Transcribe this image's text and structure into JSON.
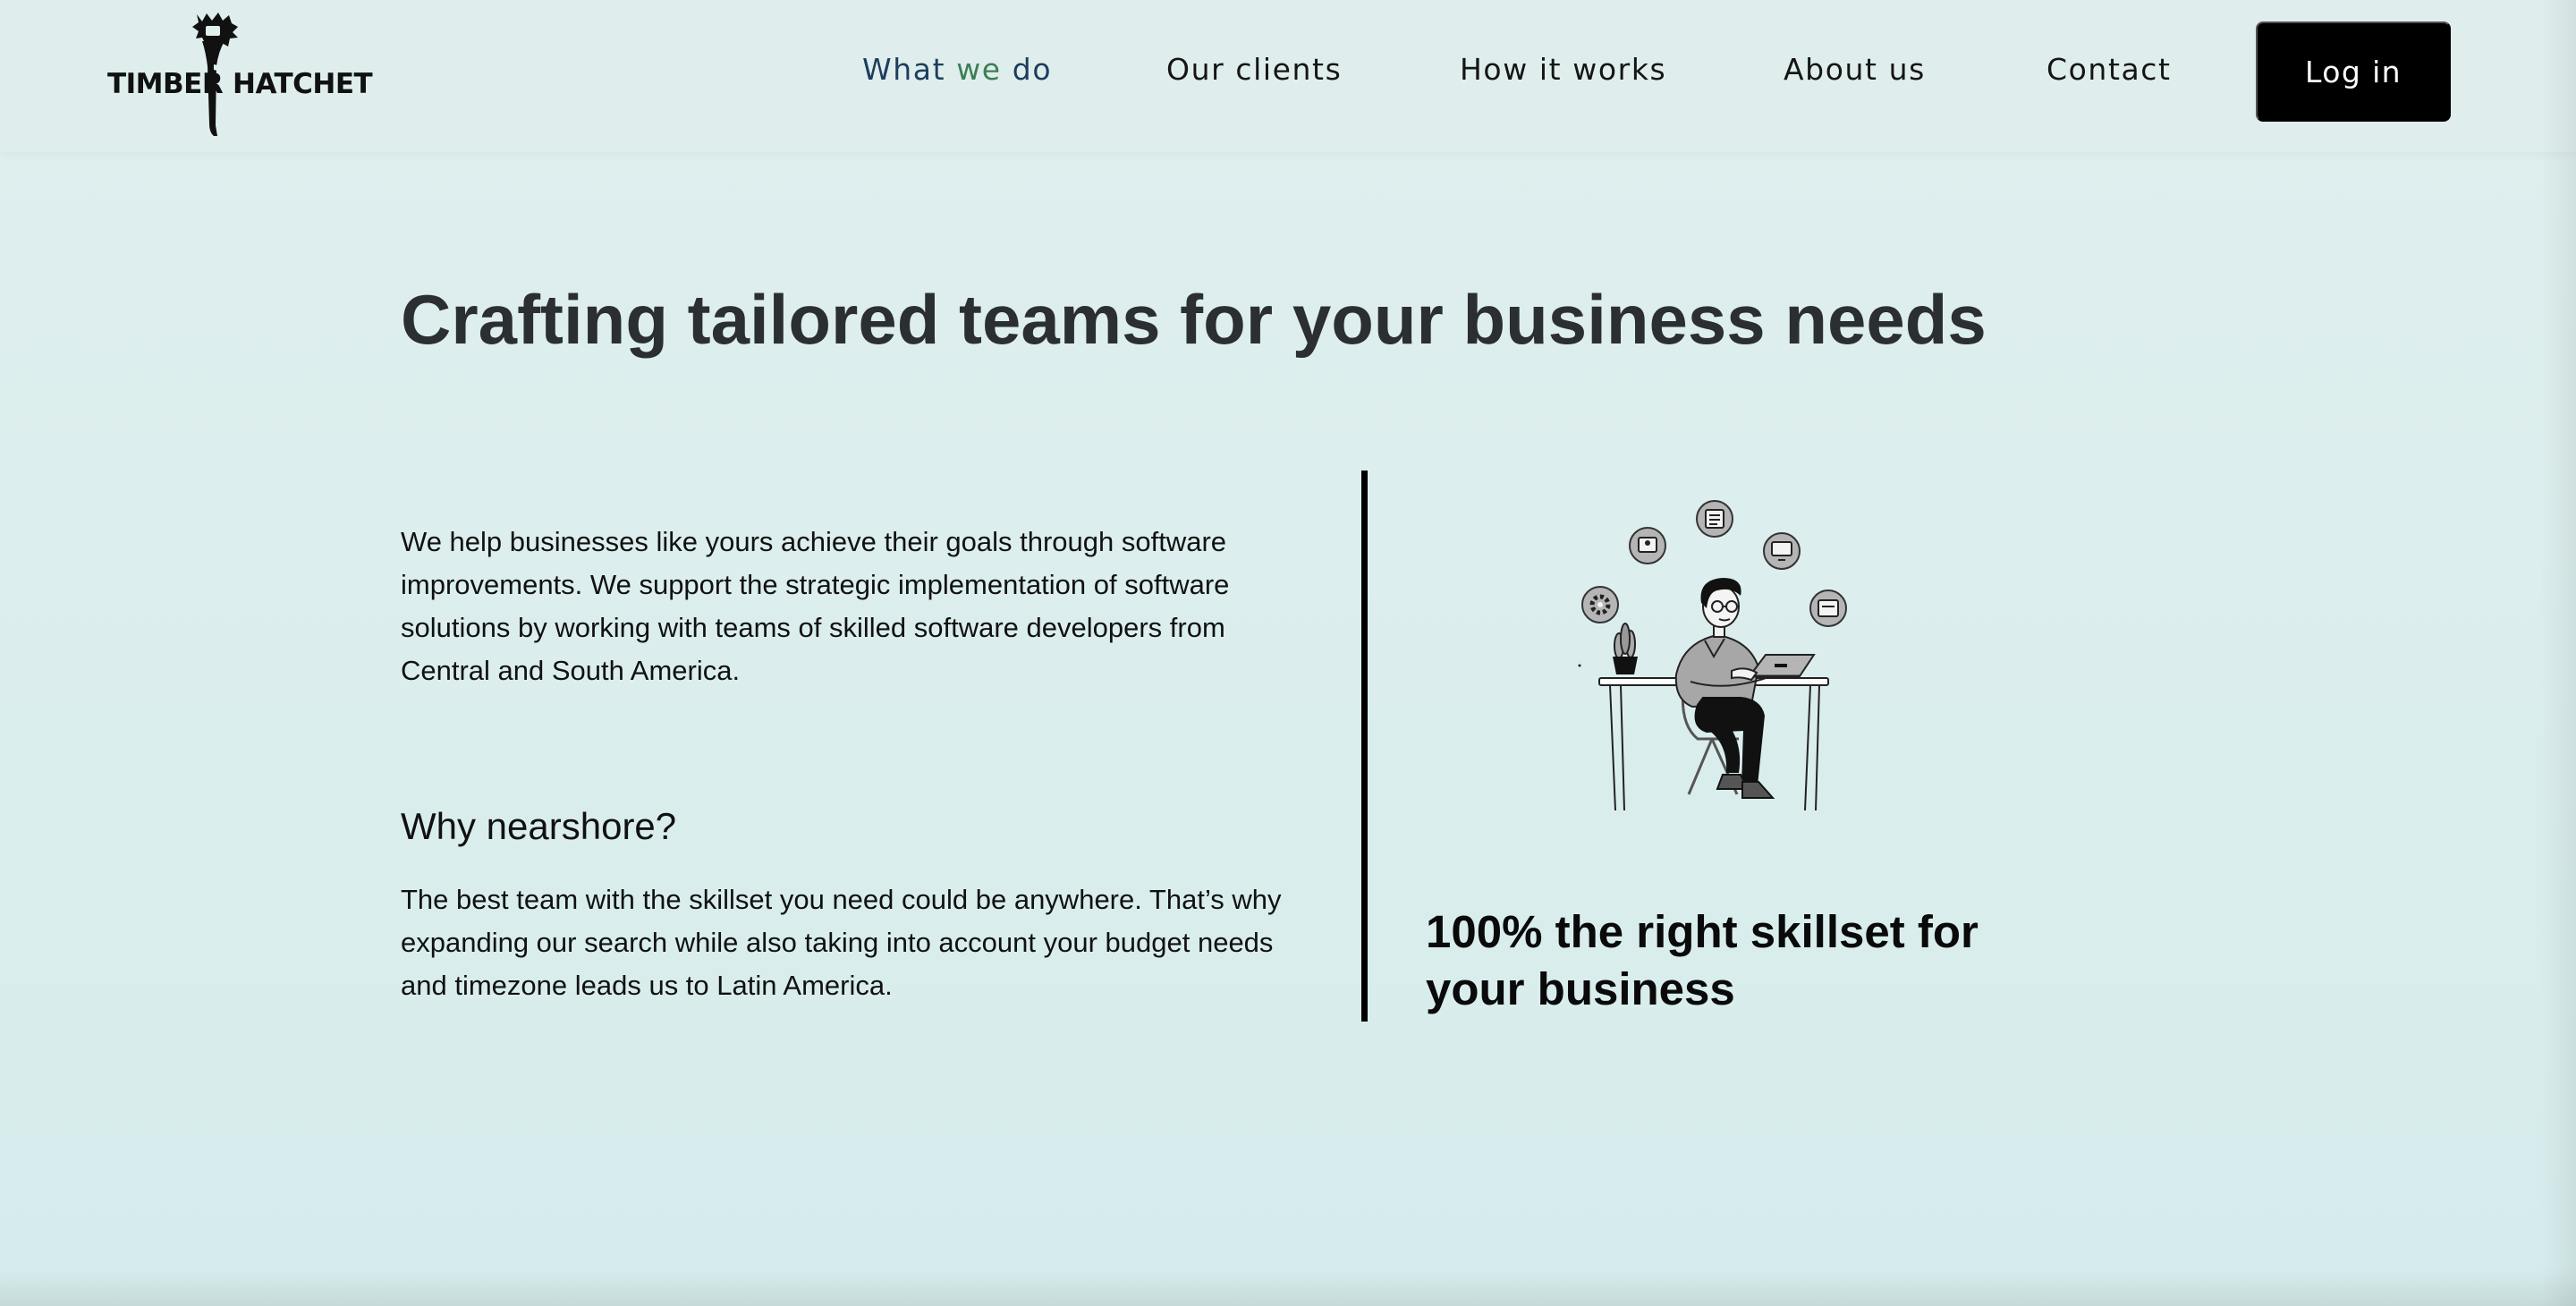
{
  "header": {
    "logo": {
      "text_left": "TIMBER",
      "text_right": "HATCHET"
    },
    "nav": [
      {
        "label": "What we do",
        "label_start": "What ",
        "label_accent": "we",
        "label_end": " do",
        "active": true
      },
      {
        "label": "Our clients"
      },
      {
        "label": "How it works"
      },
      {
        "label": "About us"
      },
      {
        "label": "Contact"
      }
    ],
    "login_label": "Log in"
  },
  "hero": {
    "title": "Crafting tailored teams for your business needs",
    "intro": "We help businesses like yours achieve their goals through software improvements. We support the strategic implementation of software solutions by working with teams of skilled software developers from Central and South America.",
    "why_title": "Why nearshore?",
    "why_text": "The best team with the skillset you need could be anywhere. That’s why expanding our search while also taking into account your budget needs and timezone leads us to Latin America.",
    "skill_title": "100% the right skillset for your business"
  },
  "colors": {
    "background": "#dcedec",
    "nav_active": "#1e3d5d",
    "nav_active_accent": "#3d7f55",
    "login_button": "#000000",
    "heading": "#2b2f31"
  },
  "icons": {
    "logo": "hatchet-logo-icon",
    "illustration": "developer-at-desk-illustration",
    "bubbles": [
      "gear-bubble-icon",
      "user-card-bubble-icon",
      "document-bubble-icon",
      "monitor-bubble-icon",
      "code-bubble-icon"
    ]
  }
}
